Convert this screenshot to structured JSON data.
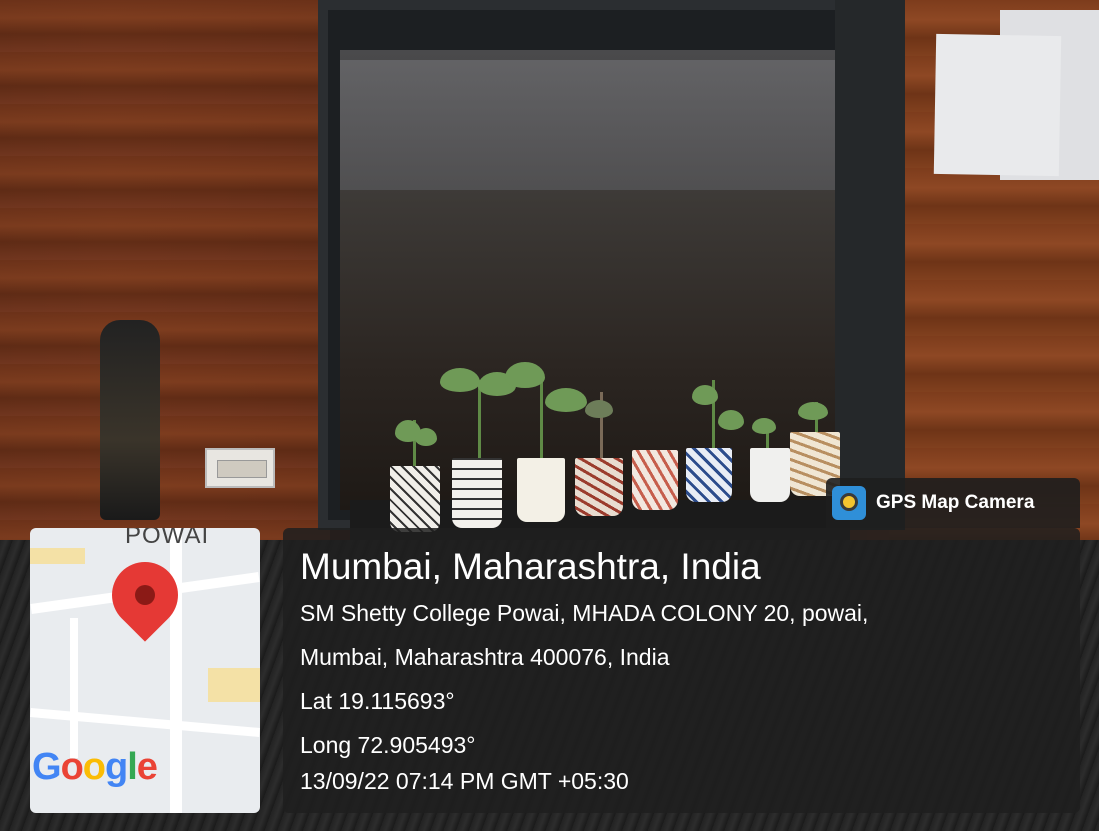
{
  "overlay": {
    "badge_label": "GPS Map Camera",
    "location_title": "Mumbai, Maharashtra, India",
    "address_line_1": "SM Shetty College Powai, MHADA COLONY 20, powai,",
    "address_line_2": "Mumbai, Maharashtra 400076, India",
    "latitude": "Lat 19.115693°",
    "longitude": "Long 72.905493°",
    "timestamp": "13/09/22 07:14 PM GMT +05:30"
  },
  "map": {
    "area_label": "POWAI",
    "google_logo": "Google",
    "pin_color": "#e53935",
    "pin_icon": "map-pin-icon"
  },
  "badge_icon": "gps-map-camera-icon"
}
